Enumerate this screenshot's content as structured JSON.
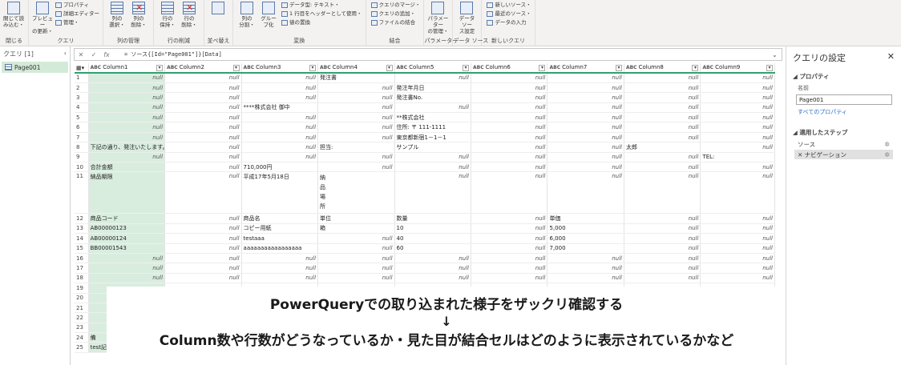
{
  "ribbon": {
    "groups": [
      {
        "label": "閉じる",
        "big": [
          {
            "label": "閉じて読\nみ込む・",
            "icon": "close-load-icon"
          }
        ],
        "small": []
      },
      {
        "label": "クエリ",
        "big": [
          {
            "label": "プレビュー\nの更新・",
            "icon": "refresh-icon"
          }
        ],
        "small": [
          "プロパティ",
          "詳細エディター",
          "管理・"
        ]
      },
      {
        "label": "列の管理",
        "big": [
          {
            "label": "列の\n選択・",
            "icon": "choose-columns-icon"
          },
          {
            "label": "列の\n削除・",
            "icon": "remove-columns-icon"
          }
        ],
        "small": []
      },
      {
        "label": "行の削減",
        "big": [
          {
            "label": "行の\n保持・",
            "icon": "keep-rows-icon"
          },
          {
            "label": "行の\n削除・",
            "icon": "remove-rows-icon"
          }
        ],
        "small": []
      },
      {
        "label": "並べ替え",
        "big": [
          {
            "label": "",
            "icon": "sort-icon"
          }
        ],
        "small": []
      },
      {
        "label": "変換",
        "big": [
          {
            "label": "列の\n分割・",
            "icon": "split-column-icon"
          },
          {
            "label": "グルー\nプ化",
            "icon": "group-by-icon"
          }
        ],
        "small": [
          "データ型: テキスト・",
          "1 行目をヘッダーとして使用・",
          "値の置換"
        ]
      },
      {
        "label": "結合",
        "big": [],
        "small": [
          "クエリのマージ・",
          "クエリの追加・",
          "ファイルの結合"
        ]
      },
      {
        "label": "パラメーター",
        "big": [
          {
            "label": "パラメーター\nの管理・",
            "icon": "parameters-icon"
          }
        ],
        "small": []
      },
      {
        "label": "データ ソース",
        "big": [
          {
            "label": "データ ソー\nス設定",
            "icon": "data-source-settings-icon"
          }
        ],
        "small": []
      },
      {
        "label": "新しいクエリ",
        "big": [],
        "small": [
          "新しいソース・",
          "最近のソース・",
          "データの入力"
        ]
      }
    ]
  },
  "queries_pane": {
    "header": "クエリ [1]",
    "items": [
      "Page001"
    ]
  },
  "formula_bar": {
    "text": "= ソース{[Id=\"Page001\"]}[Data]"
  },
  "columns": [
    "Column1",
    "Column2",
    "Column3",
    "Column4",
    "Column5",
    "Column6",
    "Column7",
    "Column8",
    "Column9"
  ],
  "rows": [
    [
      "1",
      "null",
      "null",
      "null",
      "発注書",
      "null",
      "null",
      "null",
      "null",
      "null"
    ],
    [
      "2",
      "null",
      "null",
      "null",
      "null",
      "発注年月日",
      "null",
      "null",
      "null",
      "null"
    ],
    [
      "3",
      "null",
      "null",
      "null",
      "null",
      "発注書No.",
      "null",
      "null",
      "null",
      "null"
    ],
    [
      "4",
      "null",
      "null",
      "****株式会社 御中",
      "null",
      "null",
      "null",
      "null",
      "null",
      "null"
    ],
    [
      "5",
      "null",
      "null",
      "null",
      "null",
      "**株式会社",
      "null",
      "null",
      "null",
      "null"
    ],
    [
      "6",
      "null",
      "null",
      "null",
      "null",
      "住所: 〒 111-1111",
      "null",
      "null",
      "null",
      "null"
    ],
    [
      "7",
      "null",
      "null",
      "null",
      "null",
      "東京都新宿1－1－1",
      "null",
      "null",
      "null",
      "null"
    ],
    [
      "8",
      "下記の通り、発注いたします。",
      "null",
      "null",
      "担当:",
      "サンプル",
      "null",
      "null",
      "太郎",
      "null"
    ],
    [
      "9",
      "null",
      "null",
      "null",
      "null",
      "null",
      "null",
      "null",
      "null",
      "TEL:"
    ],
    [
      "10",
      "合計金額",
      "null",
      "710,000円",
      "null",
      "null",
      "null",
      "null",
      "null",
      "null"
    ],
    [
      "11",
      "納品期限",
      "null",
      "平成17年5月18日",
      "納\n品\n場\n所",
      "null",
      "null",
      "null",
      "null",
      "null"
    ],
    [
      "12",
      "商品コード",
      "null",
      "商品名",
      "単位",
      "数量",
      "null",
      "単価",
      "null",
      "null"
    ],
    [
      "13",
      "AB00000123",
      "null",
      "コピー用紙",
      "箱",
      "10",
      "null",
      "5,000",
      "null",
      "null"
    ],
    [
      "14",
      "AB00000124",
      "null",
      "testaaa",
      "null",
      "40",
      "null",
      "6,000",
      "null",
      "null"
    ],
    [
      "15",
      "BB00001543",
      "null",
      "aaaaaaaaaaaaaaaaa",
      "null",
      "60",
      "null",
      "7,000",
      "null",
      "null"
    ],
    [
      "16",
      "null",
      "null",
      "null",
      "null",
      "null",
      "null",
      "null",
      "null",
      "null"
    ],
    [
      "17",
      "null",
      "null",
      "null",
      "null",
      "null",
      "null",
      "null",
      "null",
      "null"
    ],
    [
      "18",
      "null",
      "null",
      "null",
      "null",
      "null",
      "null",
      "null",
      "null",
      "null"
    ],
    [
      "19",
      "",
      "",
      "",
      "",
      "",
      "",
      "",
      "",
      ""
    ],
    [
      "20",
      "",
      "",
      "",
      "",
      "",
      "",
      "",
      "",
      ""
    ],
    [
      "21",
      "",
      "",
      "",
      "",
      "",
      "",
      "",
      "",
      ""
    ],
    [
      "22",
      "",
      "",
      "",
      "",
      "",
      "",
      "",
      "",
      ""
    ],
    [
      "23",
      "",
      "",
      "",
      "",
      "",
      "",
      "",
      "",
      ""
    ],
    [
      "24",
      "備",
      "",
      "",
      "",
      "",
      "",
      "",
      "",
      ""
    ],
    [
      "25",
      "test記載",
      "",
      "",
      "",
      "",
      "",
      "",
      "",
      ""
    ]
  ],
  "overlay": {
    "line1": "PowerQueryでの取り込まれた様子をザックリ確認する",
    "line2": "↓",
    "line3": "Column数や行数がどうなっているか・見た目が結合セルはどのように表示されているかなど"
  },
  "settings_pane": {
    "title": "クエリの設定",
    "properties_header": "プロパティ",
    "name_label": "名前",
    "name_value": "Page001",
    "all_properties_link": "すべてのプロパティ",
    "applied_steps_header": "適用したステップ",
    "steps": [
      "ソース",
      "ナビゲーション"
    ],
    "selected_step": 1
  },
  "colors": {
    "accent_green": "#33a06e",
    "column1_fill": "#d9eddf",
    "query_item": "#d4ead8"
  }
}
